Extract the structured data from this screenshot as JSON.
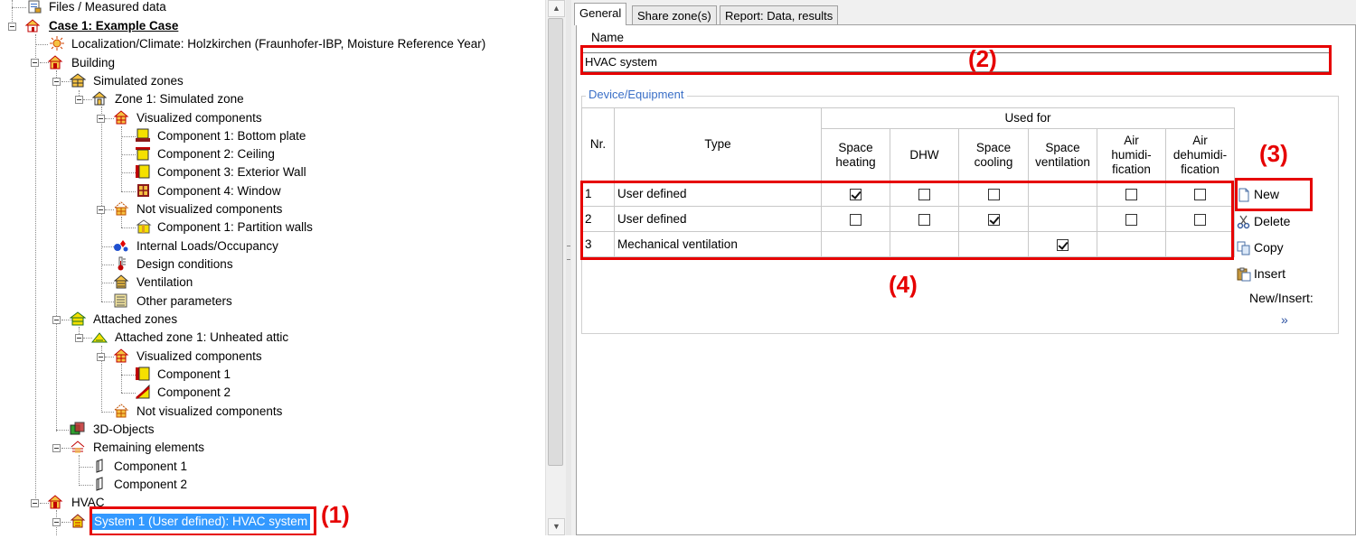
{
  "tree": {
    "items": [
      {
        "label": "Files / Measured data",
        "icon": "files-icon"
      },
      {
        "label": "Case 1: Example Case",
        "icon": "case-house-icon"
      },
      {
        "label": "Localization/Climate: Holzkirchen (Fraunhofer-IBP, Moisture Reference Year)",
        "icon": "climate-sun-icon"
      },
      {
        "label": "Building",
        "icon": "building-icon"
      },
      {
        "label": "Simulated zones",
        "icon": "simulated-zones-icon"
      },
      {
        "label": "Zone 1: Simulated zone",
        "icon": "zone-icon"
      },
      {
        "label": "Visualized components",
        "icon": "visualized-components-icon"
      },
      {
        "label": "Component 1: Bottom plate",
        "icon": "bottom-plate-icon"
      },
      {
        "label": "Component 2: Ceiling",
        "icon": "ceiling-icon"
      },
      {
        "label": "Component 3: Exterior Wall",
        "icon": "exterior-wall-icon"
      },
      {
        "label": "Component 4: Window",
        "icon": "window-icon"
      },
      {
        "label": "Not visualized components",
        "icon": "not-visualized-components-icon"
      },
      {
        "label": "Component 1: Partition walls",
        "icon": "partition-wall-icon"
      },
      {
        "label": "Internal Loads/Occupancy",
        "icon": "internal-loads-icon"
      },
      {
        "label": "Design conditions",
        "icon": "thermometer-icon"
      },
      {
        "label": "Ventilation",
        "icon": "ventilation-icon"
      },
      {
        "label": "Other parameters",
        "icon": "other-parameters-icon"
      },
      {
        "label": "Attached zones",
        "icon": "attached-zones-icon"
      },
      {
        "label": "Attached zone 1: Unheated attic",
        "icon": "attic-icon"
      },
      {
        "label": "Visualized components",
        "icon": "visualized-components-icon"
      },
      {
        "label": "Component 1",
        "icon": "component-wall-icon"
      },
      {
        "label": "Component 2",
        "icon": "component-roof-icon"
      },
      {
        "label": "Not visualized components",
        "icon": "not-visualized-components-icon"
      },
      {
        "label": "3D-Objects",
        "icon": "3d-objects-icon"
      },
      {
        "label": "Remaining elements",
        "icon": "remaining-elements-icon"
      },
      {
        "label": "Component 1",
        "icon": "element-icon"
      },
      {
        "label": "Component 2",
        "icon": "element-icon"
      },
      {
        "label": "HVAC",
        "icon": "hvac-icon"
      },
      {
        "label": "System 1 (User defined): HVAC system",
        "icon": "hvac-system-icon"
      }
    ]
  },
  "tabs": [
    "General",
    "Share zone(s)",
    "Report: Data, results"
  ],
  "general": {
    "name_label": "Name",
    "name_value": "HVAC system",
    "group_label": "Device/Equipment"
  },
  "table": {
    "header_nr": "Nr.",
    "header_type": "Type",
    "header_used_for": "Used for",
    "columns": [
      {
        "line1": "Space",
        "line2": "heating",
        "line3": ""
      },
      {
        "line1": "DHW",
        "line2": "",
        "line3": ""
      },
      {
        "line1": "Space",
        "line2": "cooling",
        "line3": ""
      },
      {
        "line1": "Space",
        "line2": "ventilation",
        "line3": ""
      },
      {
        "line1": "Air",
        "line2": "humidi-",
        "line3": "fication"
      },
      {
        "line1": "Air",
        "line2": "dehumidi-",
        "line3": "fication"
      }
    ],
    "rows": [
      {
        "nr": "1",
        "type": "User defined",
        "checks": [
          true,
          false,
          false,
          null,
          false,
          false
        ]
      },
      {
        "nr": "2",
        "type": "User defined",
        "checks": [
          false,
          false,
          true,
          null,
          false,
          false
        ]
      },
      {
        "nr": "3",
        "type": "Mechanical ventilation",
        "checks": [
          null,
          null,
          null,
          true,
          null,
          null
        ]
      }
    ]
  },
  "buttons": {
    "new": "New",
    "delete": "Delete",
    "copy": "Copy",
    "insert": "Insert",
    "new_insert": "New/Insert:",
    "more": "»"
  },
  "annotations": [
    "(1)",
    "(2)",
    "(3)",
    "(4)"
  ],
  "colors": {
    "annotation_red": "#e60000",
    "selection_blue": "#3399ff",
    "group_label_blue": "#3a6fc7"
  }
}
